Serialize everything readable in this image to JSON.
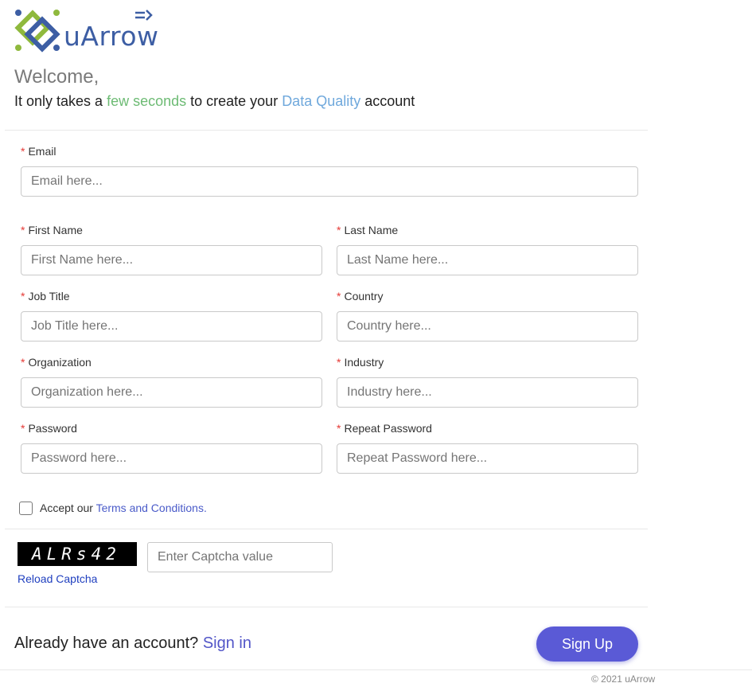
{
  "brand": {
    "name": "uArrow"
  },
  "header": {
    "welcome": "Welcome,",
    "tagline_pre": "It only takes a ",
    "tagline_green": "few seconds",
    "tagline_mid": " to create your ",
    "tagline_blue": "Data Quality",
    "tagline_post": " account"
  },
  "form": {
    "required_marker": "*",
    "email": {
      "label": "Email",
      "placeholder": "Email here..."
    },
    "first_name": {
      "label": "First Name",
      "placeholder": "First Name here..."
    },
    "last_name": {
      "label": "Last Name",
      "placeholder": "Last Name here..."
    },
    "job_title": {
      "label": "Job Title",
      "placeholder": "Job Title here..."
    },
    "country": {
      "label": "Country",
      "placeholder": "Country here..."
    },
    "organization": {
      "label": "Organization",
      "placeholder": "Organization here..."
    },
    "industry": {
      "label": "Industry",
      "placeholder": "Industry here..."
    },
    "password": {
      "label": "Password",
      "placeholder": "Password here..."
    },
    "repeat_password": {
      "label": "Repeat Password",
      "placeholder": "Repeat Password here..."
    },
    "terms": {
      "prefix": "Accept our ",
      "link": "Terms and Conditions.",
      "checked": false
    }
  },
  "captcha": {
    "code": "ALRs42",
    "placeholder": "Enter Captcha value",
    "reload_label": "Reload Captcha"
  },
  "footer": {
    "already_text": "Already have an account? ",
    "sign_in": "Sign in",
    "signup_button": "Sign Up",
    "copyright": "© 2021 uArrow"
  },
  "colors": {
    "logo_blue": "#3d5ea4",
    "logo_green": "#8fb93d",
    "accent_green": "#6dbb74",
    "accent_blue": "#6fa8dc",
    "required_red": "#e53935",
    "link_blue": "#4a5bc9",
    "button_purple": "#5a5ad6"
  }
}
